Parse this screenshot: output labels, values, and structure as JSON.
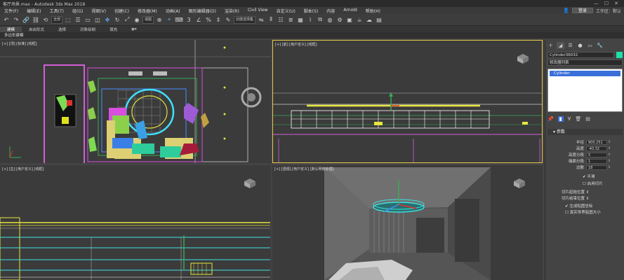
{
  "window": {
    "title": "客厅场景.max - Autodesk 3ds Max 2018",
    "login": "登录",
    "workspace": "工作区：默认"
  },
  "menu": [
    "文件(F)",
    "编辑(E)",
    "工具(T)",
    "组(G)",
    "视图(V)",
    "创建(C)",
    "修改器(M)",
    "动画(A)",
    "图形编辑器(D)",
    "渲染(R)",
    "Civil View",
    "自定义(U)",
    "脚本(S)",
    "内容",
    "Arnold",
    "帮助(H)"
  ],
  "toolbar": {
    "filter": "全部",
    "refcoord": "视图",
    "selset": "创建选择集"
  },
  "ribbon": {
    "tabs": [
      "建模",
      "自由形式",
      "选择",
      "对象绘制",
      "填充"
    ],
    "active_tab": "建模",
    "subtitle": "多边形建模"
  },
  "viewports": {
    "top": "[+] [顶] [标准] [线框]",
    "front": "[+] [前] [用户定义] [线框]",
    "left": "[+] [左] [用户定义] [线框]",
    "persp": "[+] [透视] [用户定义] [默认明暗处理]"
  },
  "panel": {
    "object_name": "Cylinder36032",
    "object_color": "#1ee0a8",
    "modifier_list": "修改器列表",
    "stack_item": "Cylinder",
    "rollout": "参数",
    "params": [
      {
        "label": "半径",
        "value": "900.251"
      },
      {
        "label": "高度",
        "value": "-40.32"
      },
      {
        "label": "高度分段",
        "value": "5"
      },
      {
        "label": "端面分段",
        "value": "1"
      },
      {
        "label": "边数",
        "value": "18"
      }
    ],
    "smooth": "平滑",
    "slice_on": "启用切片",
    "slice_from": "切片起始位置",
    "slice_to": "切片结束位置",
    "gen_mapping": "生成贴图坐标",
    "real_world": "真实世界贴图大小"
  }
}
